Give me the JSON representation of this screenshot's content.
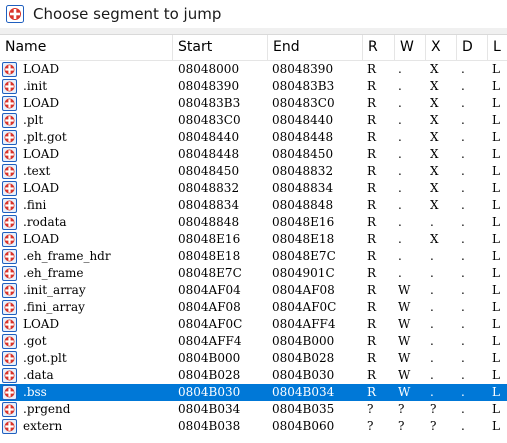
{
  "window": {
    "title": "Choose segment to jump"
  },
  "columns": [
    {
      "key": "name",
      "label": "Name"
    },
    {
      "key": "start",
      "label": "Start"
    },
    {
      "key": "end",
      "label": "End"
    },
    {
      "key": "r",
      "label": "R"
    },
    {
      "key": "w",
      "label": "W"
    },
    {
      "key": "x",
      "label": "X"
    },
    {
      "key": "d",
      "label": "D"
    },
    {
      "key": "l",
      "label": "L"
    }
  ],
  "rows": [
    {
      "name": "LOAD",
      "start": "08048000",
      "end": "08048390",
      "r": "R",
      "w": ".",
      "x": "X",
      "d": ".",
      "l": "L"
    },
    {
      "name": ".init",
      "start": "08048390",
      "end": "080483B3",
      "r": "R",
      "w": ".",
      "x": "X",
      "d": ".",
      "l": "L"
    },
    {
      "name": "LOAD",
      "start": "080483B3",
      "end": "080483C0",
      "r": "R",
      "w": ".",
      "x": "X",
      "d": ".",
      "l": "L"
    },
    {
      "name": ".plt",
      "start": "080483C0",
      "end": "08048440",
      "r": "R",
      "w": ".",
      "x": "X",
      "d": ".",
      "l": "L"
    },
    {
      "name": ".plt.got",
      "start": "08048440",
      "end": "08048448",
      "r": "R",
      "w": ".",
      "x": "X",
      "d": ".",
      "l": "L"
    },
    {
      "name": "LOAD",
      "start": "08048448",
      "end": "08048450",
      "r": "R",
      "w": ".",
      "x": "X",
      "d": ".",
      "l": "L"
    },
    {
      "name": ".text",
      "start": "08048450",
      "end": "08048832",
      "r": "R",
      "w": ".",
      "x": "X",
      "d": ".",
      "l": "L"
    },
    {
      "name": "LOAD",
      "start": "08048832",
      "end": "08048834",
      "r": "R",
      "w": ".",
      "x": "X",
      "d": ".",
      "l": "L"
    },
    {
      "name": ".fini",
      "start": "08048834",
      "end": "08048848",
      "r": "R",
      "w": ".",
      "x": "X",
      "d": ".",
      "l": "L"
    },
    {
      "name": ".rodata",
      "start": "08048848",
      "end": "08048E16",
      "r": "R",
      "w": ".",
      "x": ".",
      "d": ".",
      "l": "L"
    },
    {
      "name": "LOAD",
      "start": "08048E16",
      "end": "08048E18",
      "r": "R",
      "w": ".",
      "x": "X",
      "d": ".",
      "l": "L"
    },
    {
      "name": ".eh_frame_hdr",
      "start": "08048E18",
      "end": "08048E7C",
      "r": "R",
      "w": ".",
      "x": ".",
      "d": ".",
      "l": "L"
    },
    {
      "name": ".eh_frame",
      "start": "08048E7C",
      "end": "0804901C",
      "r": "R",
      "w": ".",
      "x": ".",
      "d": ".",
      "l": "L"
    },
    {
      "name": ".init_array",
      "start": "0804AF04",
      "end": "0804AF08",
      "r": "R",
      "w": "W",
      "x": ".",
      "d": ".",
      "l": "L"
    },
    {
      "name": ".fini_array",
      "start": "0804AF08",
      "end": "0804AF0C",
      "r": "R",
      "w": "W",
      "x": ".",
      "d": ".",
      "l": "L"
    },
    {
      "name": "LOAD",
      "start": "0804AF0C",
      "end": "0804AFF4",
      "r": "R",
      "w": "W",
      "x": ".",
      "d": ".",
      "l": "L"
    },
    {
      "name": ".got",
      "start": "0804AFF4",
      "end": "0804B000",
      "r": "R",
      "w": "W",
      "x": ".",
      "d": ".",
      "l": "L"
    },
    {
      "name": ".got.plt",
      "start": "0804B000",
      "end": "0804B028",
      "r": "R",
      "w": "W",
      "x": ".",
      "d": ".",
      "l": "L"
    },
    {
      "name": ".data",
      "start": "0804B028",
      "end": "0804B030",
      "r": "R",
      "w": "W",
      "x": ".",
      "d": ".",
      "l": "L"
    },
    {
      "name": ".bss",
      "start": "0804B030",
      "end": "0804B034",
      "r": "R",
      "w": "W",
      "x": ".",
      "d": ".",
      "l": "L",
      "selected": true
    },
    {
      "name": ".prgend",
      "start": "0804B034",
      "end": "0804B035",
      "r": "?",
      "w": "?",
      "x": "?",
      "d": ".",
      "l": "L"
    },
    {
      "name": "extern",
      "start": "0804B038",
      "end": "0804B060",
      "r": "?",
      "w": "?",
      "x": "?",
      "d": ".",
      "l": "L"
    }
  ],
  "colors": {
    "selection": "#0078d7",
    "icon_blue": "#1f5fbf",
    "icon_red": "#d9342b"
  },
  "icons": {
    "app": "ida-segment-icon",
    "row": "segment-icon"
  }
}
